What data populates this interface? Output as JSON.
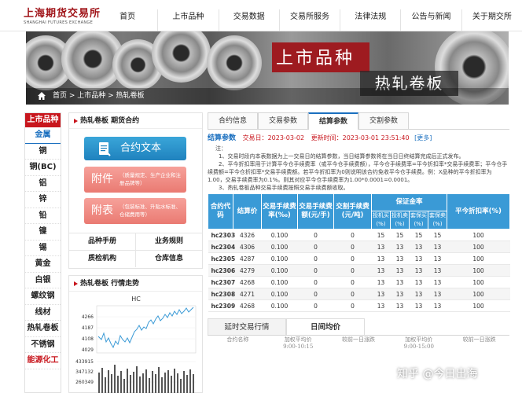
{
  "logo": {
    "cn": "上海期货交易所",
    "en": "SHANGHAI FUTURES EXCHANGE"
  },
  "nav": [
    "首页",
    "上市品种",
    "交易数据",
    "交易所服务",
    "法律法规",
    "公告与新闻",
    "关于期交所"
  ],
  "banner": {
    "title": "上市品种",
    "subtitle": "热轧卷板",
    "breadcrumb": "首页 > 上市品种 > 热轧卷板"
  },
  "sidebar": {
    "title": "上市品种",
    "items": [
      "金属",
      "铜",
      "铜(BC)",
      "铝",
      "锌",
      "铅",
      "镍",
      "锡",
      "黄金",
      "白银",
      "螺纹钢",
      "线材",
      "热轧卷板",
      "不锈钢",
      "能源化工"
    ],
    "selected": "金属"
  },
  "contract": {
    "title": "热轧卷板 期货合约",
    "contract_btn": "合约文本",
    "appendix": {
      "label": "附件",
      "desc": "（质量规定、生产企业和注册品牌等）"
    },
    "attached_table": {
      "label": "附表",
      "desc": "（包装标准、升贴水标准、仓储费用等）"
    },
    "links": [
      [
        "品种手册",
        "业务规则"
      ],
      [
        "质检机构",
        "仓库信息"
      ]
    ]
  },
  "trend": {
    "title": "热轧卷板 行情走势",
    "label": "HC",
    "price_ticks": [
      "4266",
      "4187",
      "4108",
      "4029"
    ],
    "volume_ticks": [
      "433915",
      "347132",
      "260349"
    ]
  },
  "tabs": [
    "合约信息",
    "交易参数",
    "结算参数",
    "交割参数"
  ],
  "active_tab": "结算参数",
  "settle": {
    "title": "结算参数",
    "trade_date_label": "交易日：",
    "trade_date": "2023-03-02",
    "update_label": "更新时间：",
    "update_time": "2023-03-01 23:51:40",
    "more": "[更多]"
  },
  "notes": [
    "注：",
    "1、交易时段内本表数据为上一交易日的结算参数，当日结算参数将在当日日终结算完成后正式发布。",
    "2、平今折扣率用于计算平今仓手续费率（或平今仓手续费额），平今仓手续费率=平今折扣率*交易手续费率；平今仓手续费额=平今仓折扣率*交易手续费额。若平今折扣率为0则说明该合约免收平今仓手续费。例：X品种的平今折扣率为1.00，交易手续费率为0.1%。则其对应平今仓手续费率为1.00*0.0001=0.0001。",
    "3、热轧卷板品种交易手续费按照交易手续费额收取。"
  ],
  "table": {
    "headers": [
      "合约代码",
      "结算价",
      "交易手续费率(‰)",
      "交易手续费额(元/手)",
      "交割手续费(元/吨)",
      "保证金率",
      "平今折扣率(%)"
    ],
    "margin_sub": [
      "投机买(%)",
      "投机卖(%)",
      "套保买(%)",
      "套保卖(%)"
    ],
    "rows": [
      [
        "hc2303",
        "4326",
        "0.100",
        "0",
        "0",
        "15",
        "15",
        "15",
        "15",
        "100"
      ],
      [
        "hc2304",
        "4306",
        "0.100",
        "0",
        "0",
        "13",
        "13",
        "13",
        "13",
        "100"
      ],
      [
        "hc2305",
        "4287",
        "0.100",
        "0",
        "0",
        "13",
        "13",
        "13",
        "13",
        "100"
      ],
      [
        "hc2306",
        "4279",
        "0.100",
        "0",
        "0",
        "13",
        "13",
        "13",
        "13",
        "100"
      ],
      [
        "hc2307",
        "4268",
        "0.100",
        "0",
        "0",
        "13",
        "13",
        "13",
        "13",
        "100"
      ],
      [
        "hc2308",
        "4271",
        "0.100",
        "0",
        "0",
        "13",
        "13",
        "13",
        "13",
        "100"
      ],
      [
        "hc2309",
        "4268",
        "0.100",
        "0",
        "0",
        "13",
        "13",
        "13",
        "13",
        "100"
      ]
    ]
  },
  "bottom_tabs": [
    "延时交易行情",
    "日间均价"
  ],
  "bottom_active": "日间均价",
  "avg_headers": [
    [
      "合约名称"
    ],
    [
      "加权平均价",
      "9:00-10:15"
    ],
    [
      "较前一日涨跌"
    ],
    [
      "加权平均价",
      "9:00-15:00"
    ],
    [
      "较前一日涨跌"
    ]
  ],
  "watermark": "知乎 @今日出海",
  "colors": {
    "brand_red": "#c8161d",
    "accent_blue": "#3a9ad6",
    "link_blue": "#1a6fbf"
  }
}
